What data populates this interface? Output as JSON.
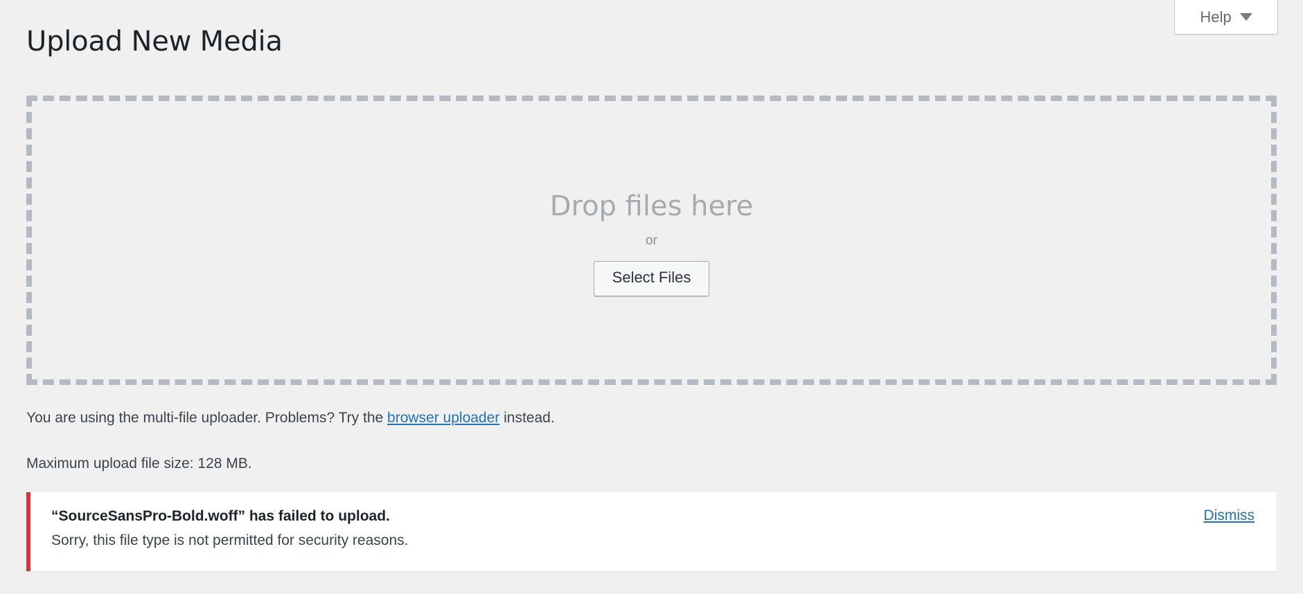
{
  "header": {
    "help_button": {
      "label": "Help",
      "caret_icon": "chevron-down-icon"
    }
  },
  "page": {
    "title": "Upload New Media",
    "background_color": "#f0f0f1"
  },
  "dropzone": {
    "heading": "Drop files here",
    "separator": "or",
    "select_button_label": "Select Files",
    "border_color": "#b4b9c2"
  },
  "info": {
    "uploader_prefix": "You are using the multi-file uploader. Problems? Try the ",
    "uploader_link": "browser uploader",
    "uploader_suffix": " instead.",
    "max_size": "Maximum upload file size: 128 MB.",
    "link_color": "#2271b1"
  },
  "notice": {
    "type": "error",
    "accent_color": "#d63638",
    "title": "“SourceSansPro-Bold.woff” has failed to upload.",
    "detail": "Sorry, this file type is not permitted for security reasons.",
    "dismiss_label": "Dismiss"
  }
}
